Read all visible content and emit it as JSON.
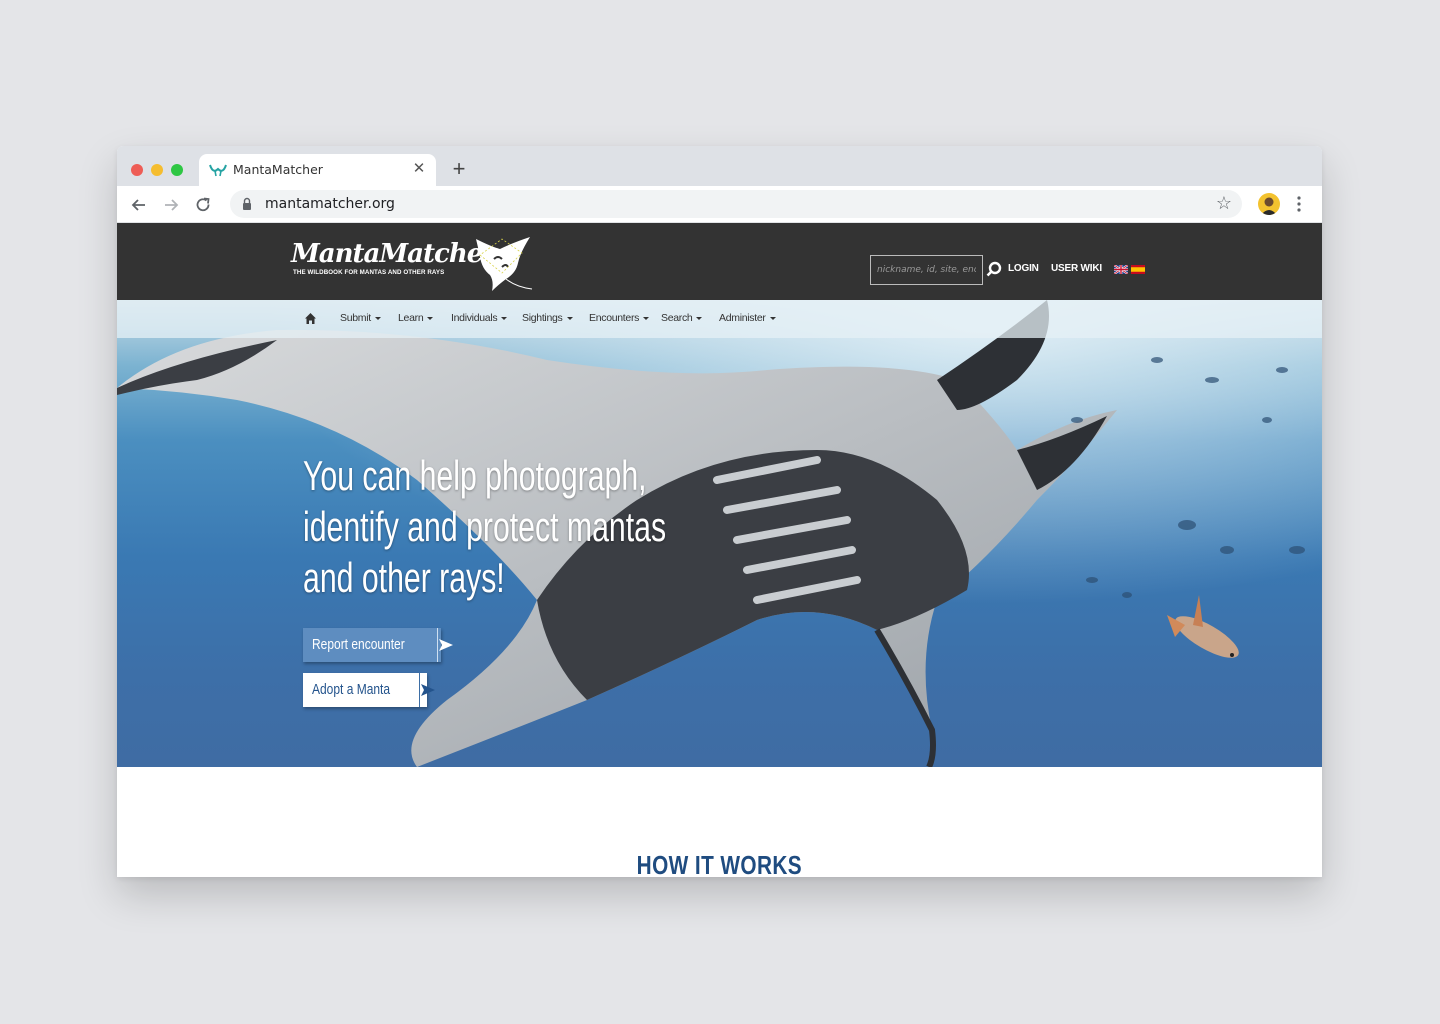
{
  "browser": {
    "tab_title": "MantaMatcher",
    "tab_close": "✕",
    "new_tab": "+",
    "url": "mantamatcher.org"
  },
  "site": {
    "logo_text": "MantaMatcher",
    "logo_subtitle": "THE WILDBOOK FOR MANTAS AND OTHER RAYS",
    "search_placeholder": "nickname, id, site, encounter",
    "login": "LOGIN",
    "user_wiki": "USER WIKI",
    "languages": [
      "english-flag",
      "spanish-flag"
    ]
  },
  "nav": {
    "items": [
      "Submit",
      "Learn",
      "Individuals",
      "Sightings",
      "Encounters",
      "Search",
      "Administer"
    ]
  },
  "hero": {
    "headline_lines": [
      "You can help photograph,",
      "identify and protect mantas",
      "and other rays!"
    ],
    "report_button": "Report encounter",
    "adopt_button": "Adopt a Manta"
  },
  "section": {
    "how_it_works": "HOW IT WORKS"
  },
  "colors": {
    "header_bg": "#333333",
    "accent_blue": "#5e8dc0",
    "heading_blue": "#1f4c80"
  }
}
